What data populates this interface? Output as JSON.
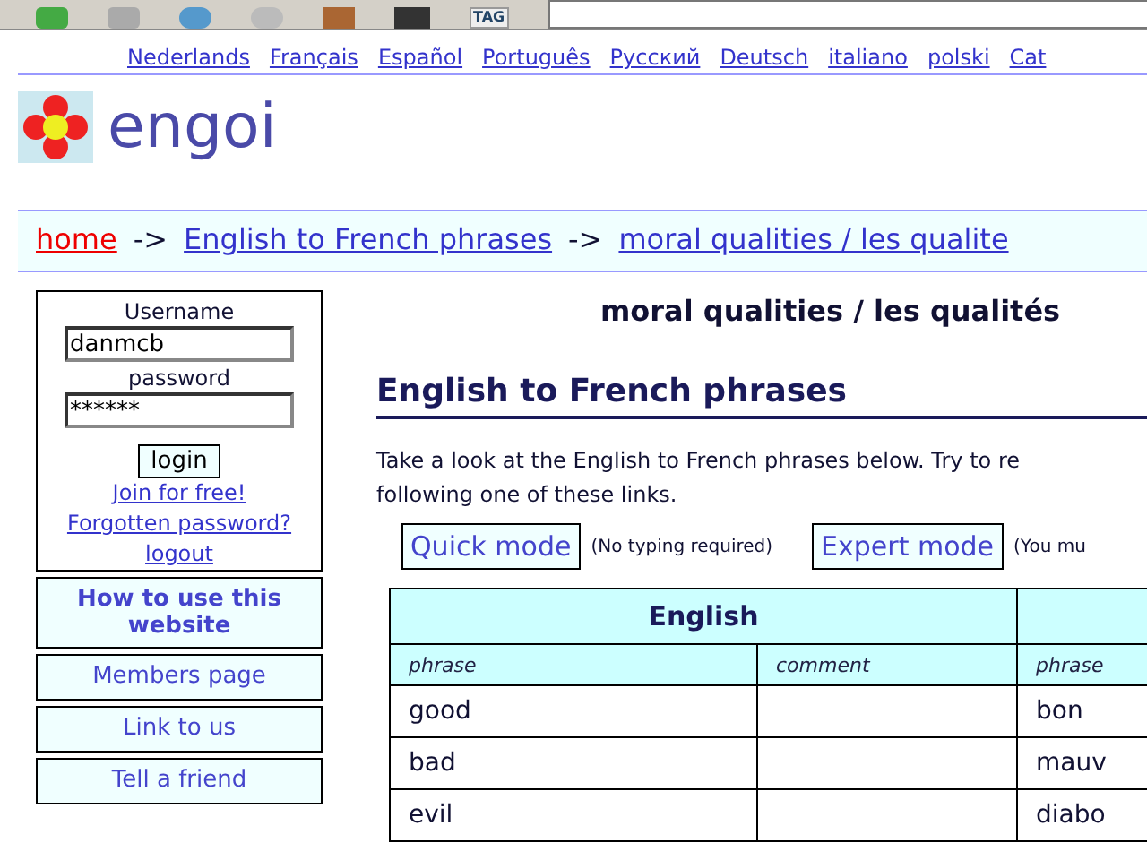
{
  "browser_toolbar": {
    "tag_label": "TAG"
  },
  "languages": [
    {
      "label": "Nederlands"
    },
    {
      "label": "Français"
    },
    {
      "label": "Español"
    },
    {
      "label": "Português"
    },
    {
      "label": "Русский"
    },
    {
      "label": "Deutsch"
    },
    {
      "label": "italiano"
    },
    {
      "label": "polski"
    },
    {
      "label": "Cat"
    }
  ],
  "site": {
    "name": "engoi"
  },
  "breadcrumb": [
    {
      "label": "home",
      "selected": true
    },
    {
      "label": "English to French phrases",
      "selected": false
    },
    {
      "label": "moral qualities / les qualite",
      "selected": false
    }
  ],
  "breadcrumb_separator": "->",
  "login": {
    "username_label": "Username",
    "username": "danmcb",
    "password_label": "password",
    "password": "******",
    "button": "login",
    "links": [
      "Join for free!",
      "Forgotten password?",
      "logout"
    ]
  },
  "sidebar_items": [
    {
      "label": "How to use this website",
      "kind": "bold"
    },
    {
      "label": "Members page",
      "kind": "plain"
    },
    {
      "label": "Link to us",
      "kind": "plain"
    },
    {
      "label": "Tell a friend",
      "kind": "plain"
    }
  ],
  "topic_title": "moral qualities / les qualités",
  "section_title": "English to French phrases",
  "intro": [
    "Take a look at the English to French phrases below. Try to re",
    "following one of these links."
  ],
  "modes": [
    {
      "label": "Quick mode",
      "note": "(No typing required)"
    },
    {
      "label": "Expert mode",
      "note": "(You mu"
    }
  ],
  "table": {
    "groups": [
      "English"
    ],
    "columns": [
      "phrase",
      "comment",
      "phrase"
    ],
    "rows": [
      [
        "good",
        "",
        "bon"
      ],
      [
        "bad",
        "",
        "mauv"
      ],
      [
        "evil",
        "",
        "diabo"
      ]
    ]
  }
}
